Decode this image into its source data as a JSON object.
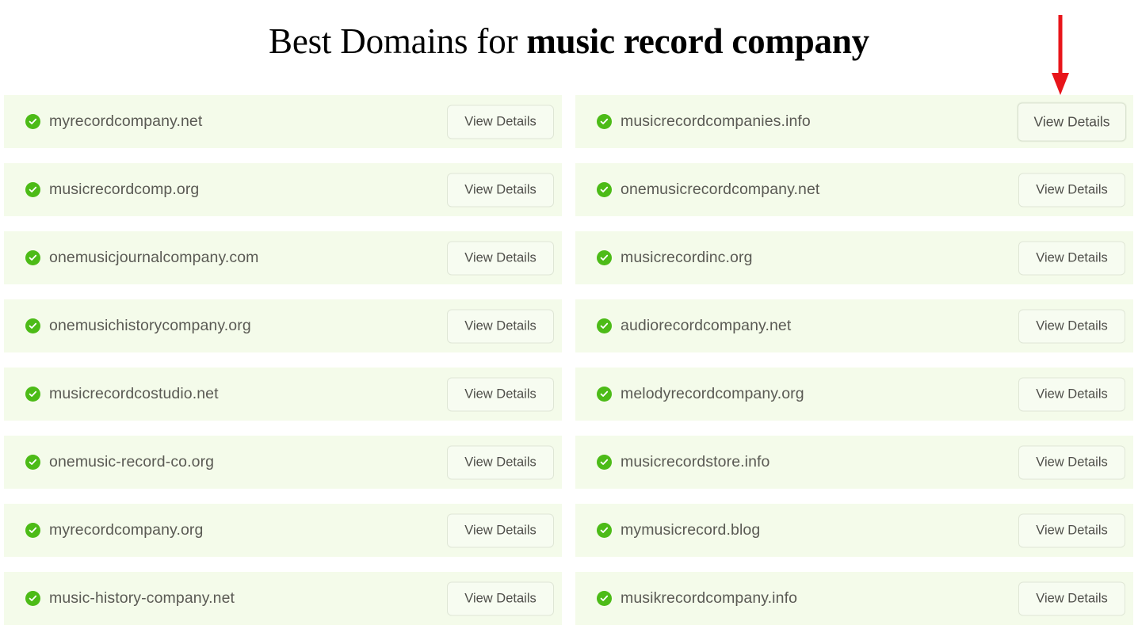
{
  "header": {
    "title_prefix": "Best Domains for ",
    "title_keyword": "music record company"
  },
  "labels": {
    "view_details": "View Details",
    "available_icon": "check-circle-icon",
    "arrow_icon": "red-down-arrow-icon"
  },
  "colors": {
    "row_background": "#f4fbea",
    "check_green": "#4cbb17",
    "domain_text": "#5a5a54",
    "button_border": "#dfe6d6",
    "arrow_red": "#e8151a"
  },
  "results": [
    {
      "domain": "myrecordcompany.net",
      "status": "available",
      "action": "View Details",
      "highlighted": false
    },
    {
      "domain": "musicrecordcompanies.info",
      "status": "available",
      "action": "View Details",
      "highlighted": true
    },
    {
      "domain": "musicrecordcomp.org",
      "status": "available",
      "action": "View Details",
      "highlighted": false
    },
    {
      "domain": "onemusicrecordcompany.net",
      "status": "available",
      "action": "View Details",
      "highlighted": false
    },
    {
      "domain": "onemusicjournalcompany.com",
      "status": "available",
      "action": "View Details",
      "highlighted": false
    },
    {
      "domain": "musicrecordinc.org",
      "status": "available",
      "action": "View Details",
      "highlighted": false
    },
    {
      "domain": "onemusichistorycompany.org",
      "status": "available",
      "action": "View Details",
      "highlighted": false
    },
    {
      "domain": "audiorecordcompany.net",
      "status": "available",
      "action": "View Details",
      "highlighted": false
    },
    {
      "domain": "musicrecordcostudio.net",
      "status": "available",
      "action": "View Details",
      "highlighted": false
    },
    {
      "domain": "melodyrecordcompany.org",
      "status": "available",
      "action": "View Details",
      "highlighted": false
    },
    {
      "domain": "onemusic-record-co.org",
      "status": "available",
      "action": "View Details",
      "highlighted": false
    },
    {
      "domain": "musicrecordstore.info",
      "status": "available",
      "action": "View Details",
      "highlighted": false
    },
    {
      "domain": "myrecordcompany.org",
      "status": "available",
      "action": "View Details",
      "highlighted": false
    },
    {
      "domain": "mymusicrecord.blog",
      "status": "available",
      "action": "View Details",
      "highlighted": false
    },
    {
      "domain": "music-history-company.net",
      "status": "available",
      "action": "View Details",
      "highlighted": false
    },
    {
      "domain": "musikrecordcompany.info",
      "status": "available",
      "action": "View Details",
      "highlighted": false
    }
  ]
}
